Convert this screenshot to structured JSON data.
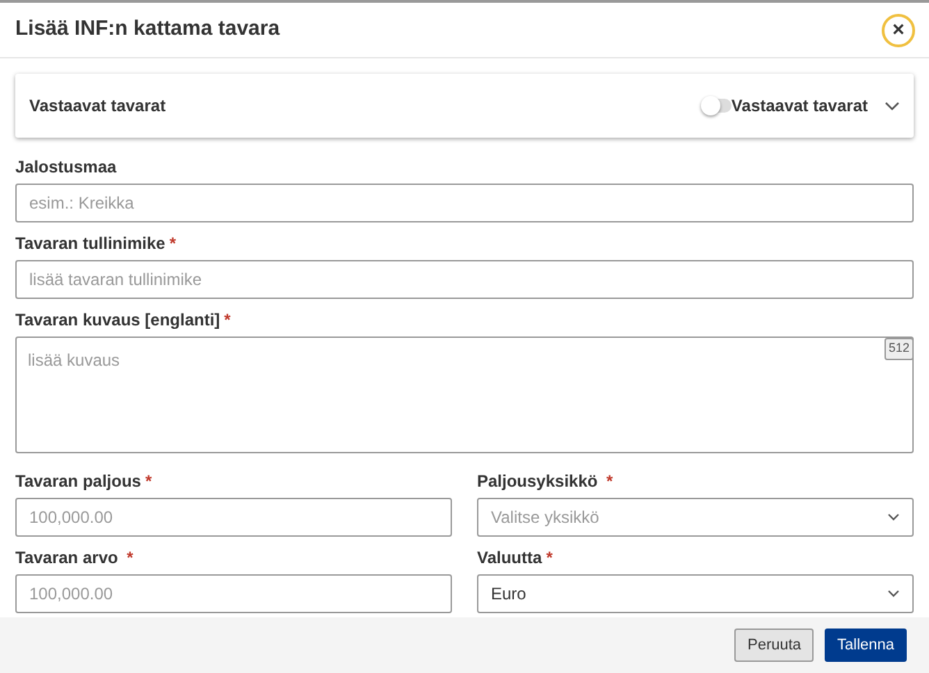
{
  "window": {
    "title": "Lisää INF:n kattama tavara",
    "close": "×"
  },
  "panel": {
    "title": "Vastaavat tavarat",
    "toggle": {
      "label": "Vastaavat tavarat",
      "on": false
    },
    "expanded": false
  },
  "rows": [
    [
      {
        "kind": "text",
        "label": "Jalostusmaa",
        "placeholder": "esim.: Kreikka"
      }
    ],
    [
      {
        "kind": "text",
        "label": "Tavaran tullinimike",
        "required_mark": "*",
        "placeholder": "lisää tavaran tullinimike"
      }
    ],
    [
      {
        "kind": "textarea",
        "label": "Tavaran kuvaus [englanti]",
        "required_mark": "*",
        "placeholder": "lisää kuvaus",
        "counter": "512"
      }
    ],
    [
      {
        "kind": "text",
        "label": "Tavaran paljous",
        "required_mark": "*",
        "placeholder": "100,000.00"
      },
      {
        "kind": "select",
        "label": "Paljousyksikkö ",
        "required_mark": "*",
        "placeholder": "Valitse yksikkö"
      }
    ],
    [
      {
        "kind": "text",
        "label": " Tavaran arvo ",
        "required_mark": "*",
        "placeholder": "100,000.00"
      },
      {
        "kind": "select",
        "label": "Valuutta",
        "required_mark": "*",
        "value": "Euro"
      }
    ]
  ],
  "buttons": [
    {
      "kind": "secondary",
      "label": "Peruuta"
    },
    {
      "kind": "primary",
      "label": "Tallenna"
    }
  ]
}
